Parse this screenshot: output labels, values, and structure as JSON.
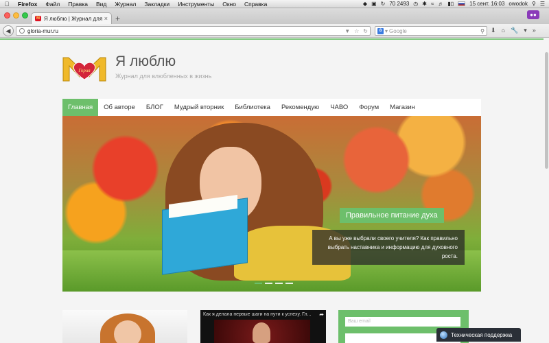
{
  "menubar": {
    "app_name": "Firefox",
    "items": [
      "Файл",
      "Правка",
      "Вид",
      "Журнал",
      "Закладки",
      "Инструменты",
      "Окно",
      "Справка"
    ],
    "status_number": "70 2493",
    "clock": "15 сент. 16:03",
    "user": "owodok"
  },
  "tab": {
    "title": "Я люблю | Журнал для вл..."
  },
  "navbar": {
    "url": "gloria-mur.ru",
    "search_placeholder": "Google",
    "search_engine_badge": "8"
  },
  "site": {
    "title": "Я люблю",
    "tagline": "Журнал для влюбленных в жизнь",
    "logo_text": "Гория"
  },
  "main_nav": [
    {
      "label": "Главная",
      "active": true
    },
    {
      "label": "Об авторе"
    },
    {
      "label": "БЛОГ"
    },
    {
      "label": "Мудрый вторник"
    },
    {
      "label": "Библиотека"
    },
    {
      "label": "Рекомендую"
    },
    {
      "label": "ЧАВО"
    },
    {
      "label": "Форум"
    },
    {
      "label": "Магазин"
    }
  ],
  "hero": {
    "caption_title": "Правильное питание духа",
    "caption_text": "А вы уже выбрали своего учителя? Как правильно выбрать наставника и информацию для духовного роста."
  },
  "video": {
    "title": "Как я делала первые шаги на пути к успеху. Гл..."
  },
  "subscribe": {
    "email_placeholder": "Ваш email"
  },
  "support": {
    "label": "Техническая поддержка"
  },
  "colors": {
    "accent_green": "#6dbf6b",
    "support_dark": "#2a2f37"
  }
}
